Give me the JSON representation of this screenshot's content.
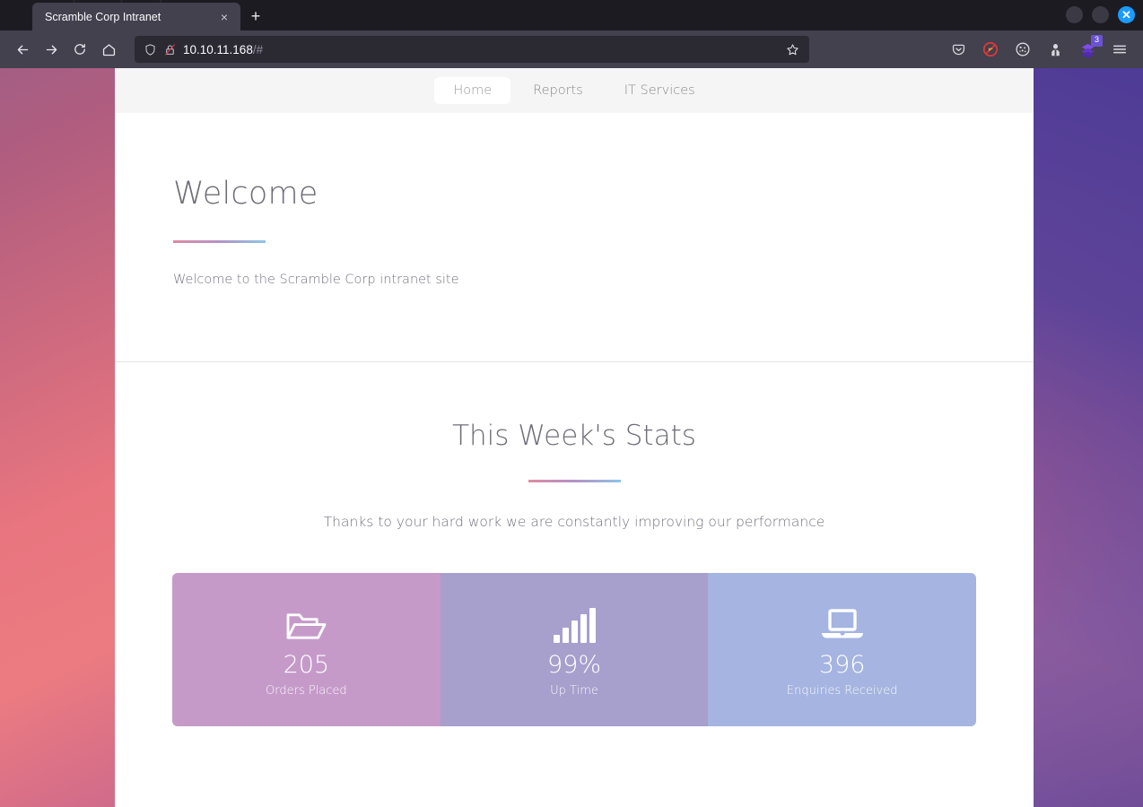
{
  "browser": {
    "tab": {
      "title": "Scramble Corp Intranet",
      "close_label": "×"
    },
    "new_tab_label": "+",
    "window_controls": {
      "minimize": "",
      "maximize": "",
      "close": "✕"
    },
    "nav": {
      "back": "back-arrow",
      "forward": "forward-arrow",
      "reload": "reload",
      "home": "home"
    },
    "url": {
      "host": "10.10.11.168",
      "path": "/#",
      "security": "insecure-http"
    },
    "toolbar_right": {
      "pocket": "pocket-icon",
      "adblock": "adblock-icon",
      "cookies": "cookie-icon",
      "privacy": "privacy-badger-icon",
      "extension": "extension-icon",
      "extension_badge": "3",
      "menu": "hamburger-menu-icon"
    }
  },
  "site": {
    "nav_items": [
      {
        "label": "Home",
        "active": true
      },
      {
        "label": "Reports",
        "active": false
      },
      {
        "label": "IT Services",
        "active": false
      }
    ],
    "welcome": {
      "title": "Welcome",
      "body": "Welcome to the Scramble Corp intranet site"
    },
    "stats": {
      "title": "This Week's Stats",
      "subtitle": "Thanks to your hard work we are constantly improving our performance",
      "cards": [
        {
          "value": "205",
          "label": "Orders Placed",
          "icon": "open-folder-icon",
          "color": "#c59ac9"
        },
        {
          "value": "99%",
          "label": "Up Time",
          "icon": "signal-bars-icon",
          "color": "#a79fcc"
        },
        {
          "value": "396",
          "label": "Enquiries Received",
          "icon": "laptop-icon",
          "color": "#a5b4e0"
        }
      ]
    },
    "accent_gradient": [
      "#e08aa4",
      "#b293c6",
      "#8ec4e8"
    ]
  }
}
